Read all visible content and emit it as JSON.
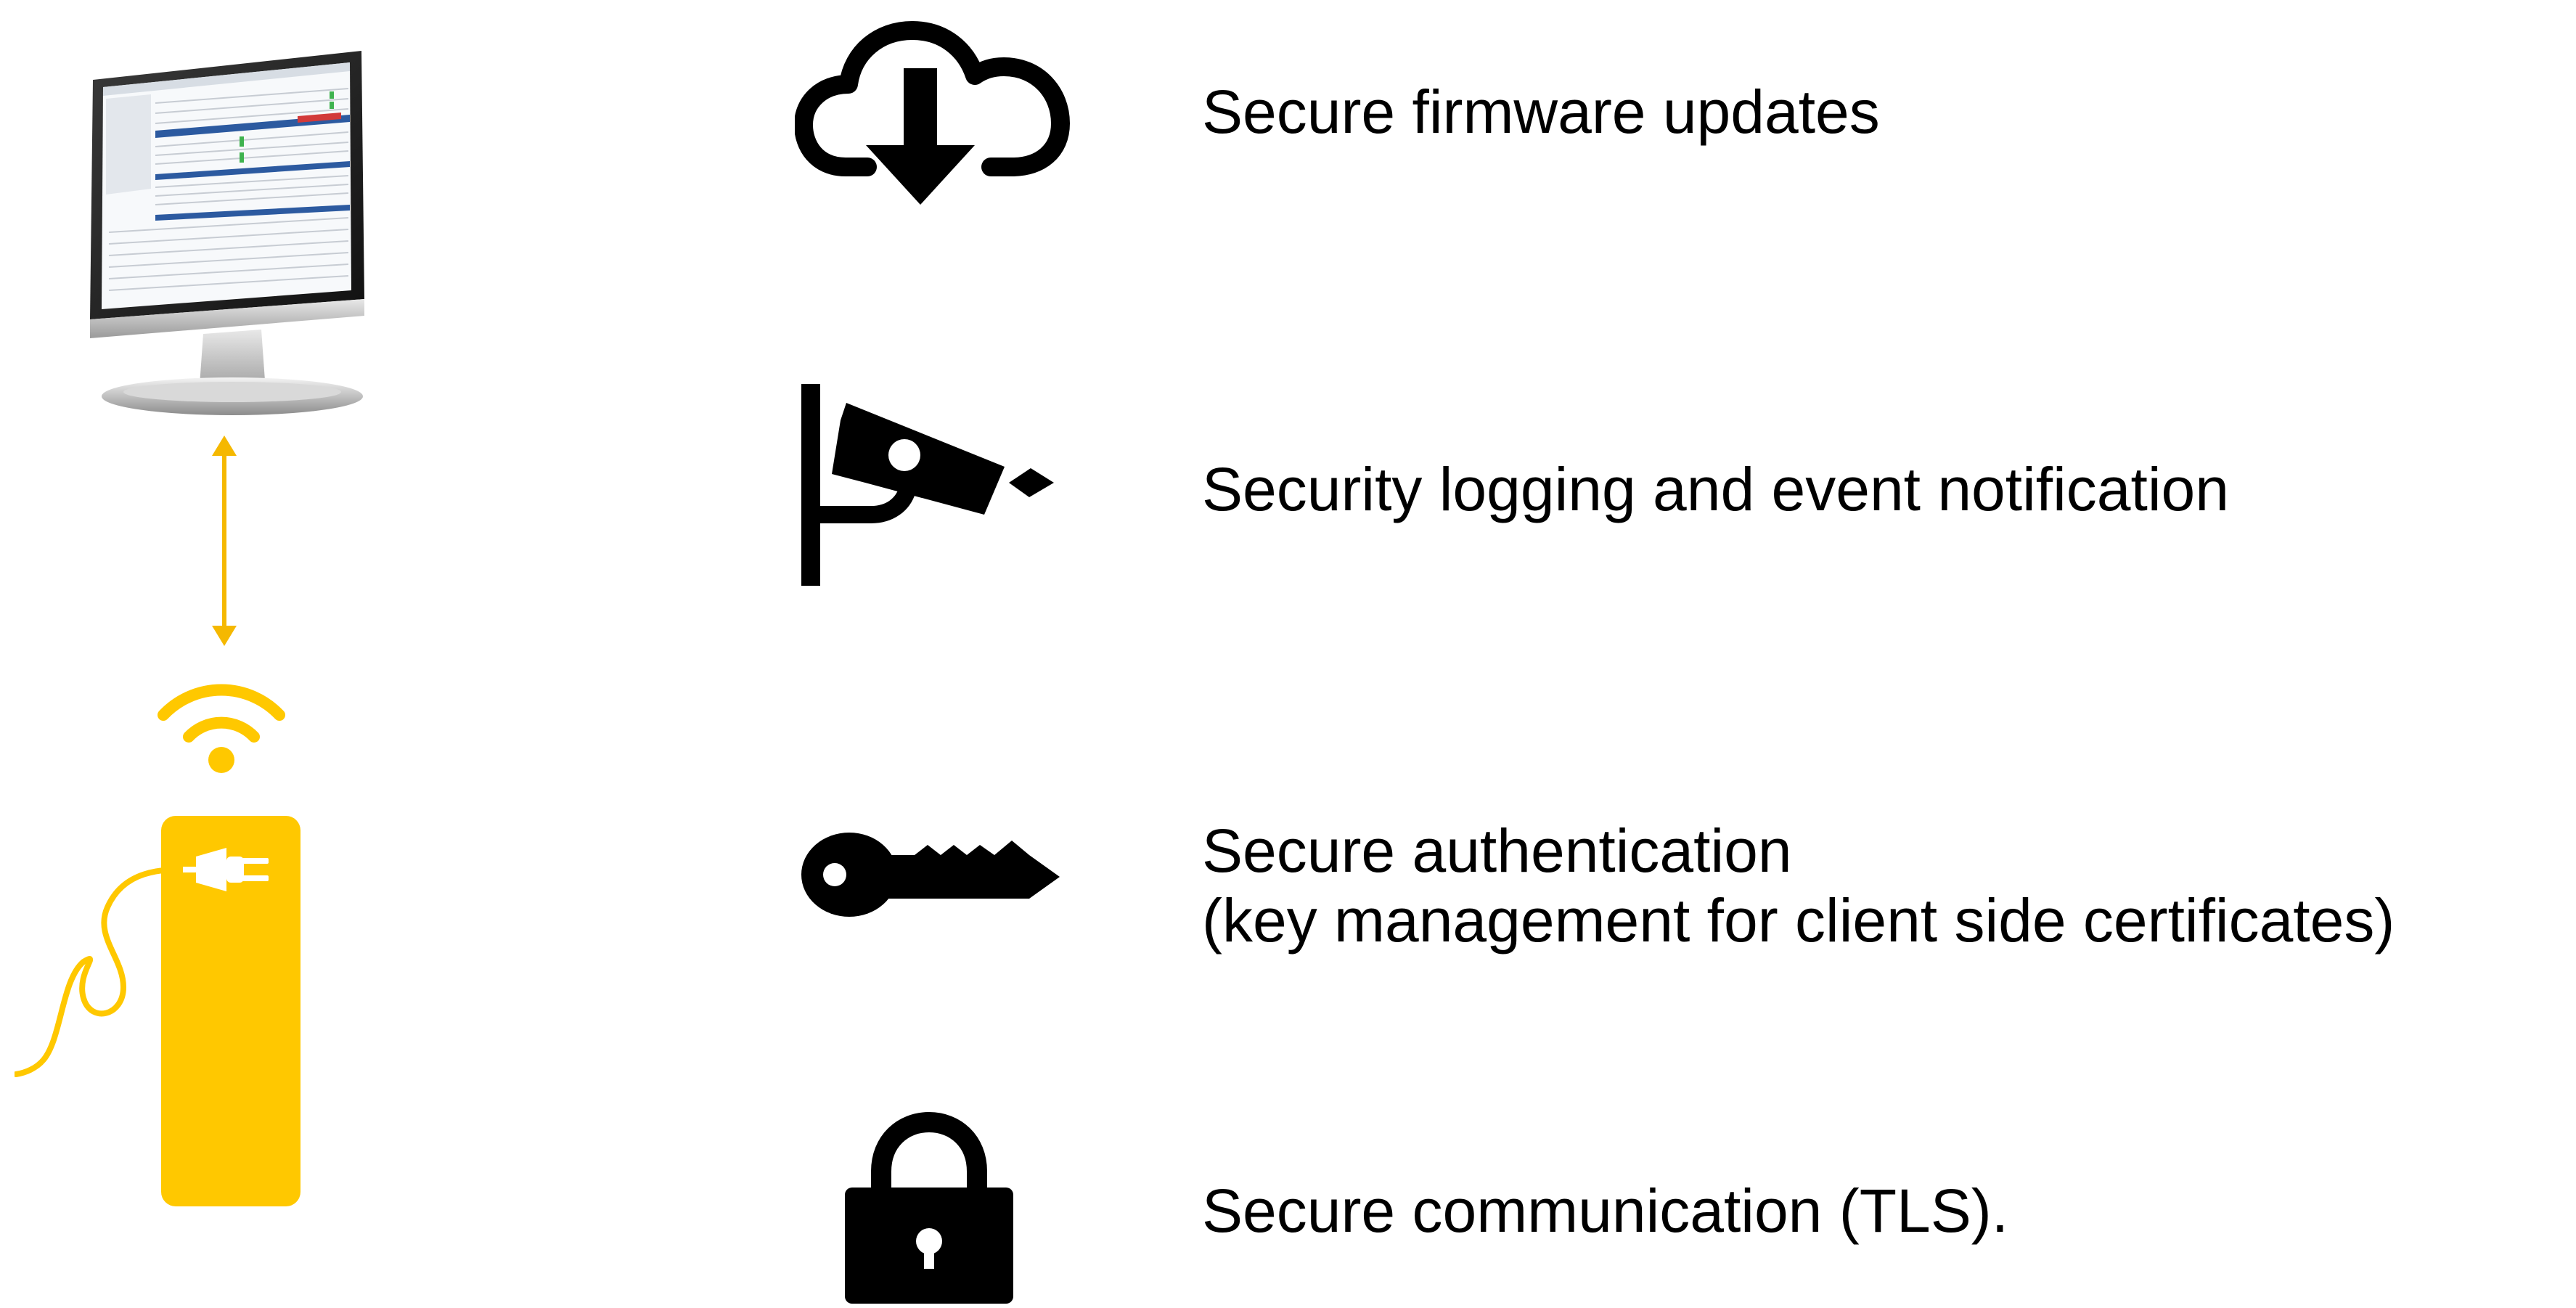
{
  "colors": {
    "accent": "#FFC800",
    "icon": "#000000",
    "text": "#000000"
  },
  "left_illustration": {
    "monitor_icon": "monitor-icon",
    "connection_icon": "double-arrow-icon",
    "wireless_icon": "wifi-icon",
    "charger_icon": "ev-charger-icon"
  },
  "features": [
    {
      "icon": "cloud-download-icon",
      "lines": [
        "Secure firmware updates"
      ]
    },
    {
      "icon": "security-camera-icon",
      "lines": [
        "Security logging and event notification"
      ]
    },
    {
      "icon": "key-icon",
      "lines": [
        "Secure authentication",
        "(key management for client side certificates)"
      ]
    },
    {
      "icon": "padlock-icon",
      "lines": [
        "Secure communication (TLS)."
      ]
    }
  ]
}
